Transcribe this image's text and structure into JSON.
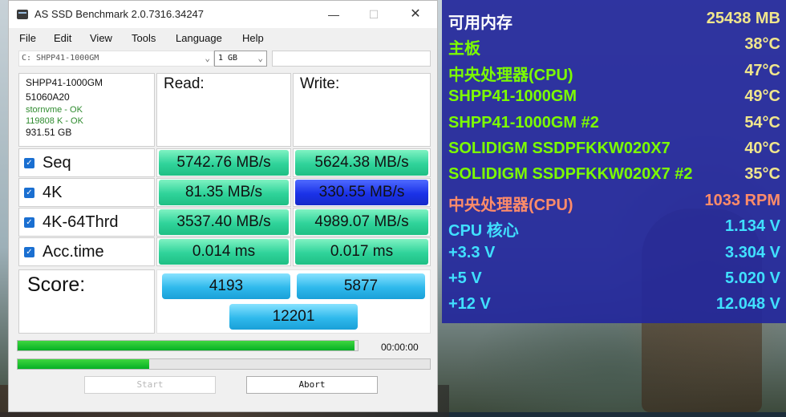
{
  "window": {
    "title": "AS SSD Benchmark 2.0.7316.34247",
    "minimize_glyph": "—",
    "maximize_glyph": "☐",
    "close_glyph": "✕"
  },
  "menu": [
    "File",
    "Edit",
    "View",
    "Tools",
    "Language",
    "Help"
  ],
  "drive_select": {
    "value": "C: SHPP41-1000GM"
  },
  "size_select": {
    "value": "1 GB"
  },
  "drive_info": {
    "model": "SHPP41-1000GM",
    "firmware": "51060A20",
    "driver": "stornvme - OK",
    "alignment": "119808 K - OK",
    "capacity": "931.51 GB"
  },
  "headers": {
    "read": "Read:",
    "write": "Write:"
  },
  "rows": [
    {
      "label": "Seq",
      "checked": true,
      "read": "5742.76 MB/s",
      "write": "5624.38 MB/s",
      "write_highlight": false
    },
    {
      "label": "4K",
      "checked": true,
      "read": "81.35 MB/s",
      "write": "330.55 MB/s",
      "write_highlight": true
    },
    {
      "label": "4K-64Thrd",
      "checked": true,
      "read": "3537.40 MB/s",
      "write": "4989.07 MB/s",
      "write_highlight": false
    },
    {
      "label": "Acc.time",
      "checked": true,
      "read": "0.014 ms",
      "write": "0.017 ms",
      "write_highlight": false
    }
  ],
  "score": {
    "label": "Score:",
    "read": "4193",
    "write": "5877",
    "total": "12201"
  },
  "progress": {
    "main_fraction": 0.99,
    "secondary_fraction": 0.32,
    "time": "00:00:00"
  },
  "buttons": {
    "start": "Start",
    "abort": "Abort"
  },
  "sensors": [
    {
      "label": "可用内存",
      "value": "25438 MB",
      "label_color": "#ffffff",
      "value_color": "#f0e68c"
    },
    {
      "label": "主板",
      "value": "38°C",
      "label_color": "#7cfc00",
      "value_color": "#f0e68c"
    },
    {
      "label": "中央处理器(CPU)",
      "value": "47°C",
      "label_color": "#7cfc00",
      "value_color": "#f0e68c"
    },
    {
      "label": "SHPP41-1000GM",
      "value": "49°C",
      "label_color": "#7cfc00",
      "value_color": "#f0e68c"
    },
    {
      "label": "SHPP41-1000GM #2",
      "value": "54°C",
      "label_color": "#7cfc00",
      "value_color": "#f0e68c"
    },
    {
      "label": "SOLIDIGM SSDPFKKW020X7",
      "value": "40°C",
      "label_color": "#7cfc00",
      "value_color": "#f0e68c"
    },
    {
      "label": "SOLIDIGM SSDPFKKW020X7 #2",
      "value": "35°C",
      "label_color": "#7cfc00",
      "value_color": "#f0e68c"
    },
    {
      "label": "中央处理器(CPU)",
      "value": "1033 RPM",
      "label_color": "#ff8c69",
      "value_color": "#ff8c69"
    },
    {
      "label": "CPU 核心",
      "value": "1.134 V",
      "label_color": "#40e0ff",
      "value_color": "#40e0ff"
    },
    {
      "label": "+3.3 V",
      "value": "3.304 V",
      "label_color": "#40e0ff",
      "value_color": "#40e0ff"
    },
    {
      "label": "+5 V",
      "value": "5.020 V",
      "label_color": "#40e0ff",
      "value_color": "#40e0ff"
    },
    {
      "label": "+12 V",
      "value": "12.048 V",
      "label_color": "#40e0ff",
      "value_color": "#40e0ff"
    }
  ]
}
